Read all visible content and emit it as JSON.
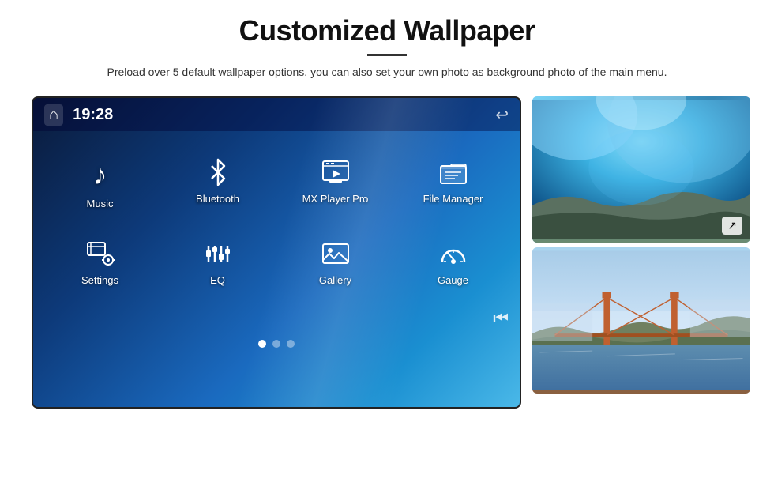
{
  "header": {
    "title": "Customized Wallpaper",
    "subtitle": "Preload over 5 default wallpaper options, you can also set your own photo as background photo of the main menu."
  },
  "screen": {
    "time": "19:28",
    "apps_row1": [
      {
        "id": "music",
        "label": "Music",
        "icon": "♪"
      },
      {
        "id": "bluetooth",
        "label": "Bluetooth",
        "icon": "bluetooth"
      },
      {
        "id": "mxplayer",
        "label": "MX Player Pro",
        "icon": "video"
      },
      {
        "id": "filemanager",
        "label": "File Manager",
        "icon": "folder"
      }
    ],
    "apps_row2": [
      {
        "id": "settings",
        "label": "Settings",
        "icon": "settings"
      },
      {
        "id": "eq",
        "label": "EQ",
        "icon": "eq"
      },
      {
        "id": "gallery",
        "label": "Gallery",
        "icon": "gallery"
      },
      {
        "id": "gauge",
        "label": "Gauge",
        "icon": "gauge"
      }
    ],
    "dots": 3,
    "active_dot": 0
  },
  "wallpapers": {
    "label1": "Ice cave wallpaper",
    "label2": "Golden Gate Bridge wallpaper"
  }
}
